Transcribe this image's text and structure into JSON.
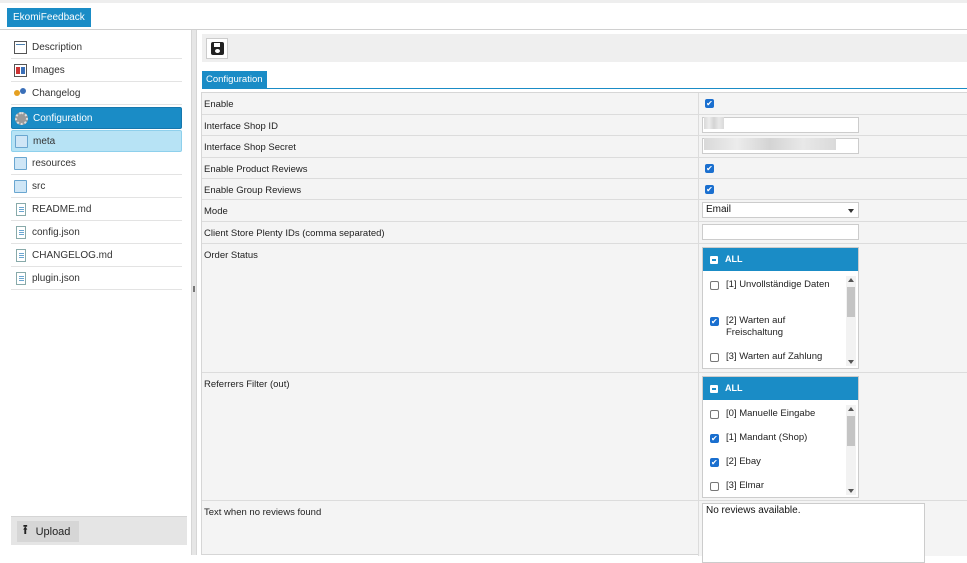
{
  "app": {
    "plugin_tab": "EkomiFeedback"
  },
  "sidebar": {
    "items": [
      {
        "label": "Description",
        "icon": "description-icon"
      },
      {
        "label": "Images",
        "icon": "images-icon"
      },
      {
        "label": "Changelog",
        "icon": "changelog-icon"
      },
      {
        "label": "Configuration",
        "icon": "gear-icon"
      },
      {
        "label": "meta",
        "icon": "folder-icon"
      },
      {
        "label": "resources",
        "icon": "folder-icon"
      },
      {
        "label": "src",
        "icon": "folder-icon"
      },
      {
        "label": "README.md",
        "icon": "file-icon"
      },
      {
        "label": "config.json",
        "icon": "file-icon"
      },
      {
        "label": "CHANGELOG.md",
        "icon": "file-icon"
      },
      {
        "label": "plugin.json",
        "icon": "file-icon"
      }
    ],
    "upload_label": "Upload"
  },
  "toolbar": {
    "save_icon": "floppy-disk-icon"
  },
  "tabs": {
    "configuration": "Configuration"
  },
  "form": {
    "enable": {
      "label": "Enable",
      "checked": true
    },
    "interface_shop_id": {
      "label": "Interface Shop ID",
      "value": ""
    },
    "interface_shop_secret": {
      "label": "Interface Shop Secret",
      "value": ""
    },
    "enable_product_reviews": {
      "label": "Enable Product Reviews",
      "checked": true
    },
    "enable_group_reviews": {
      "label": "Enable Group Reviews",
      "checked": true
    },
    "mode": {
      "label": "Mode",
      "value": "Email"
    },
    "client_store_ids": {
      "label": "Client Store Plenty IDs (comma separated)",
      "value": ""
    },
    "order_status": {
      "label": "Order Status",
      "all_label": "ALL",
      "options": [
        {
          "label": "[1] Unvollständige Daten",
          "checked": false
        },
        {
          "label": "[2] Warten auf Freischaltung",
          "checked": true
        },
        {
          "label": "[3] Warten auf Zahlung",
          "checked": false
        }
      ]
    },
    "referrers_filter": {
      "label": "Referrers Filter (out)",
      "all_label": "ALL",
      "options": [
        {
          "label": "[0] Manuelle Eingabe",
          "checked": false
        },
        {
          "label": "[1] Mandant (Shop)",
          "checked": true
        },
        {
          "label": "[2] Ebay",
          "checked": true
        },
        {
          "label": "[3] Elmar",
          "checked": false
        }
      ]
    },
    "no_reviews_text": {
      "label": "Text when no reviews found",
      "value": "No reviews available."
    }
  },
  "colors": {
    "accent": "#1a8cc6",
    "selected": "#b7e3f5",
    "checkbox": "#1a6fcf"
  }
}
